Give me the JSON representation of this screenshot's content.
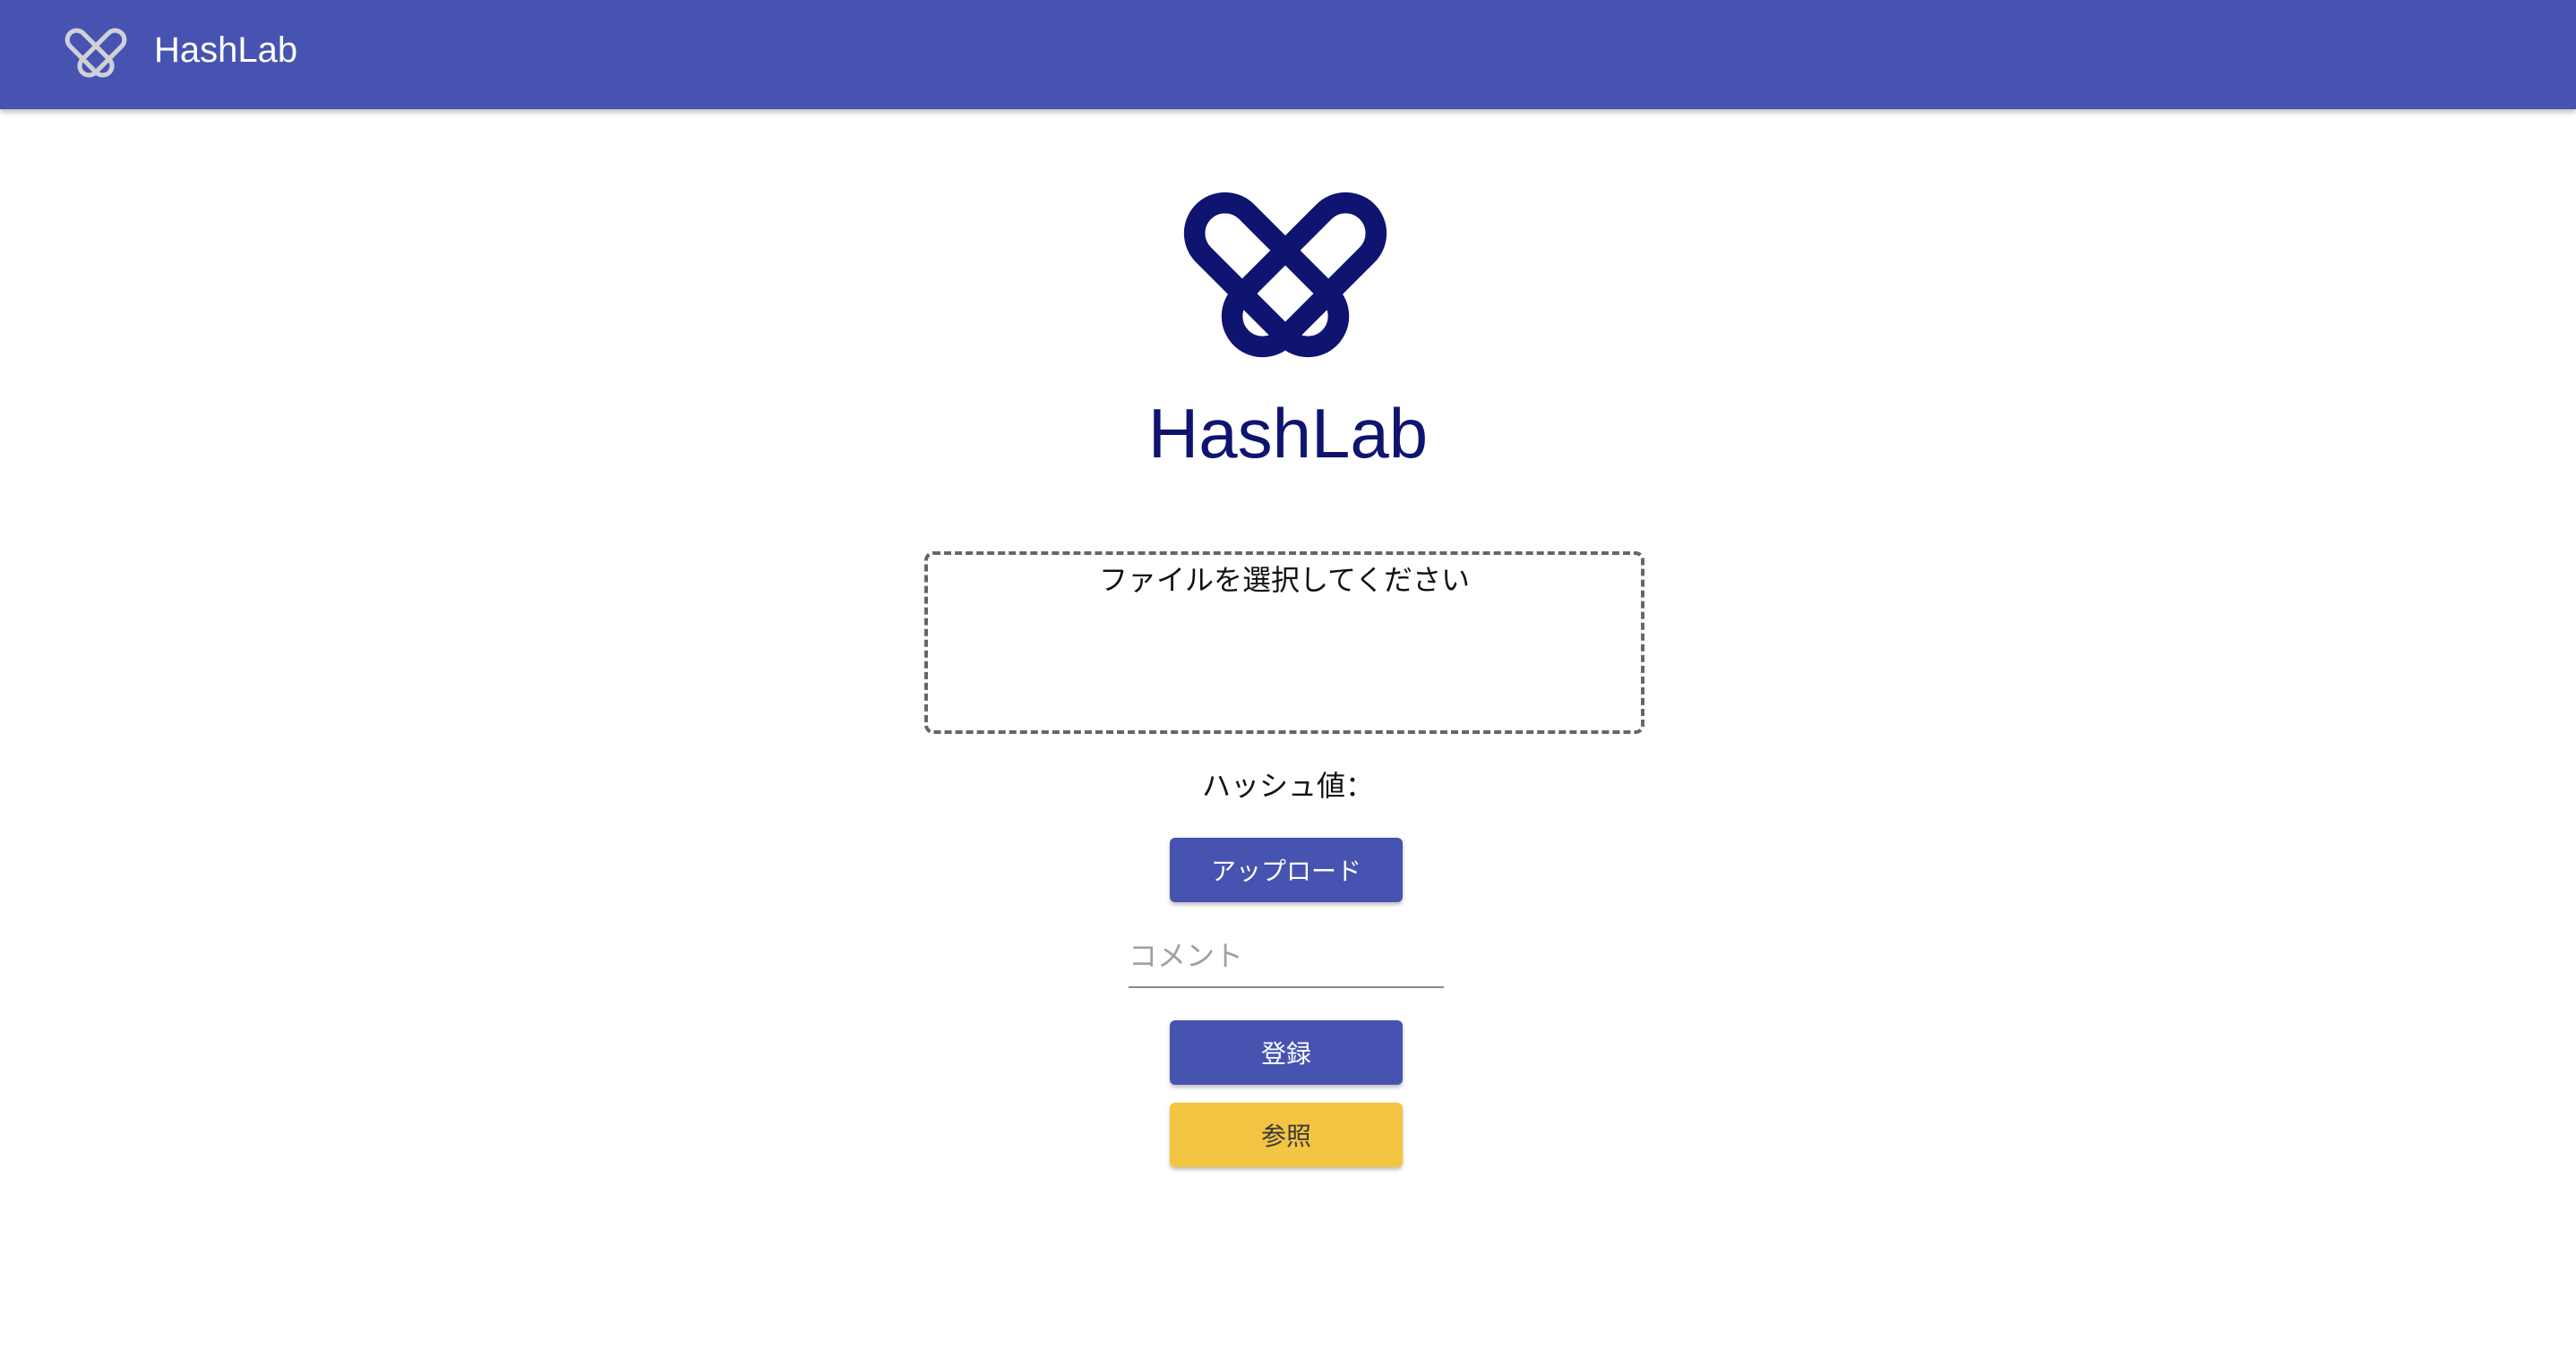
{
  "app": {
    "title": "HashLab",
    "brand_color": "#4753b0",
    "logo_color": "#0e1470",
    "logo_icon": "chain-link-icon"
  },
  "hero": {
    "title": "HashLab"
  },
  "dropzone": {
    "prompt": "ファイルを選択してください"
  },
  "hash": {
    "label": "ハッシュ値："
  },
  "actions": {
    "upload_label": "アップロード",
    "register_label": "登録",
    "reference_label": "参照",
    "reference_color": "#f4c542"
  },
  "comment": {
    "placeholder": "コメント",
    "value": ""
  }
}
